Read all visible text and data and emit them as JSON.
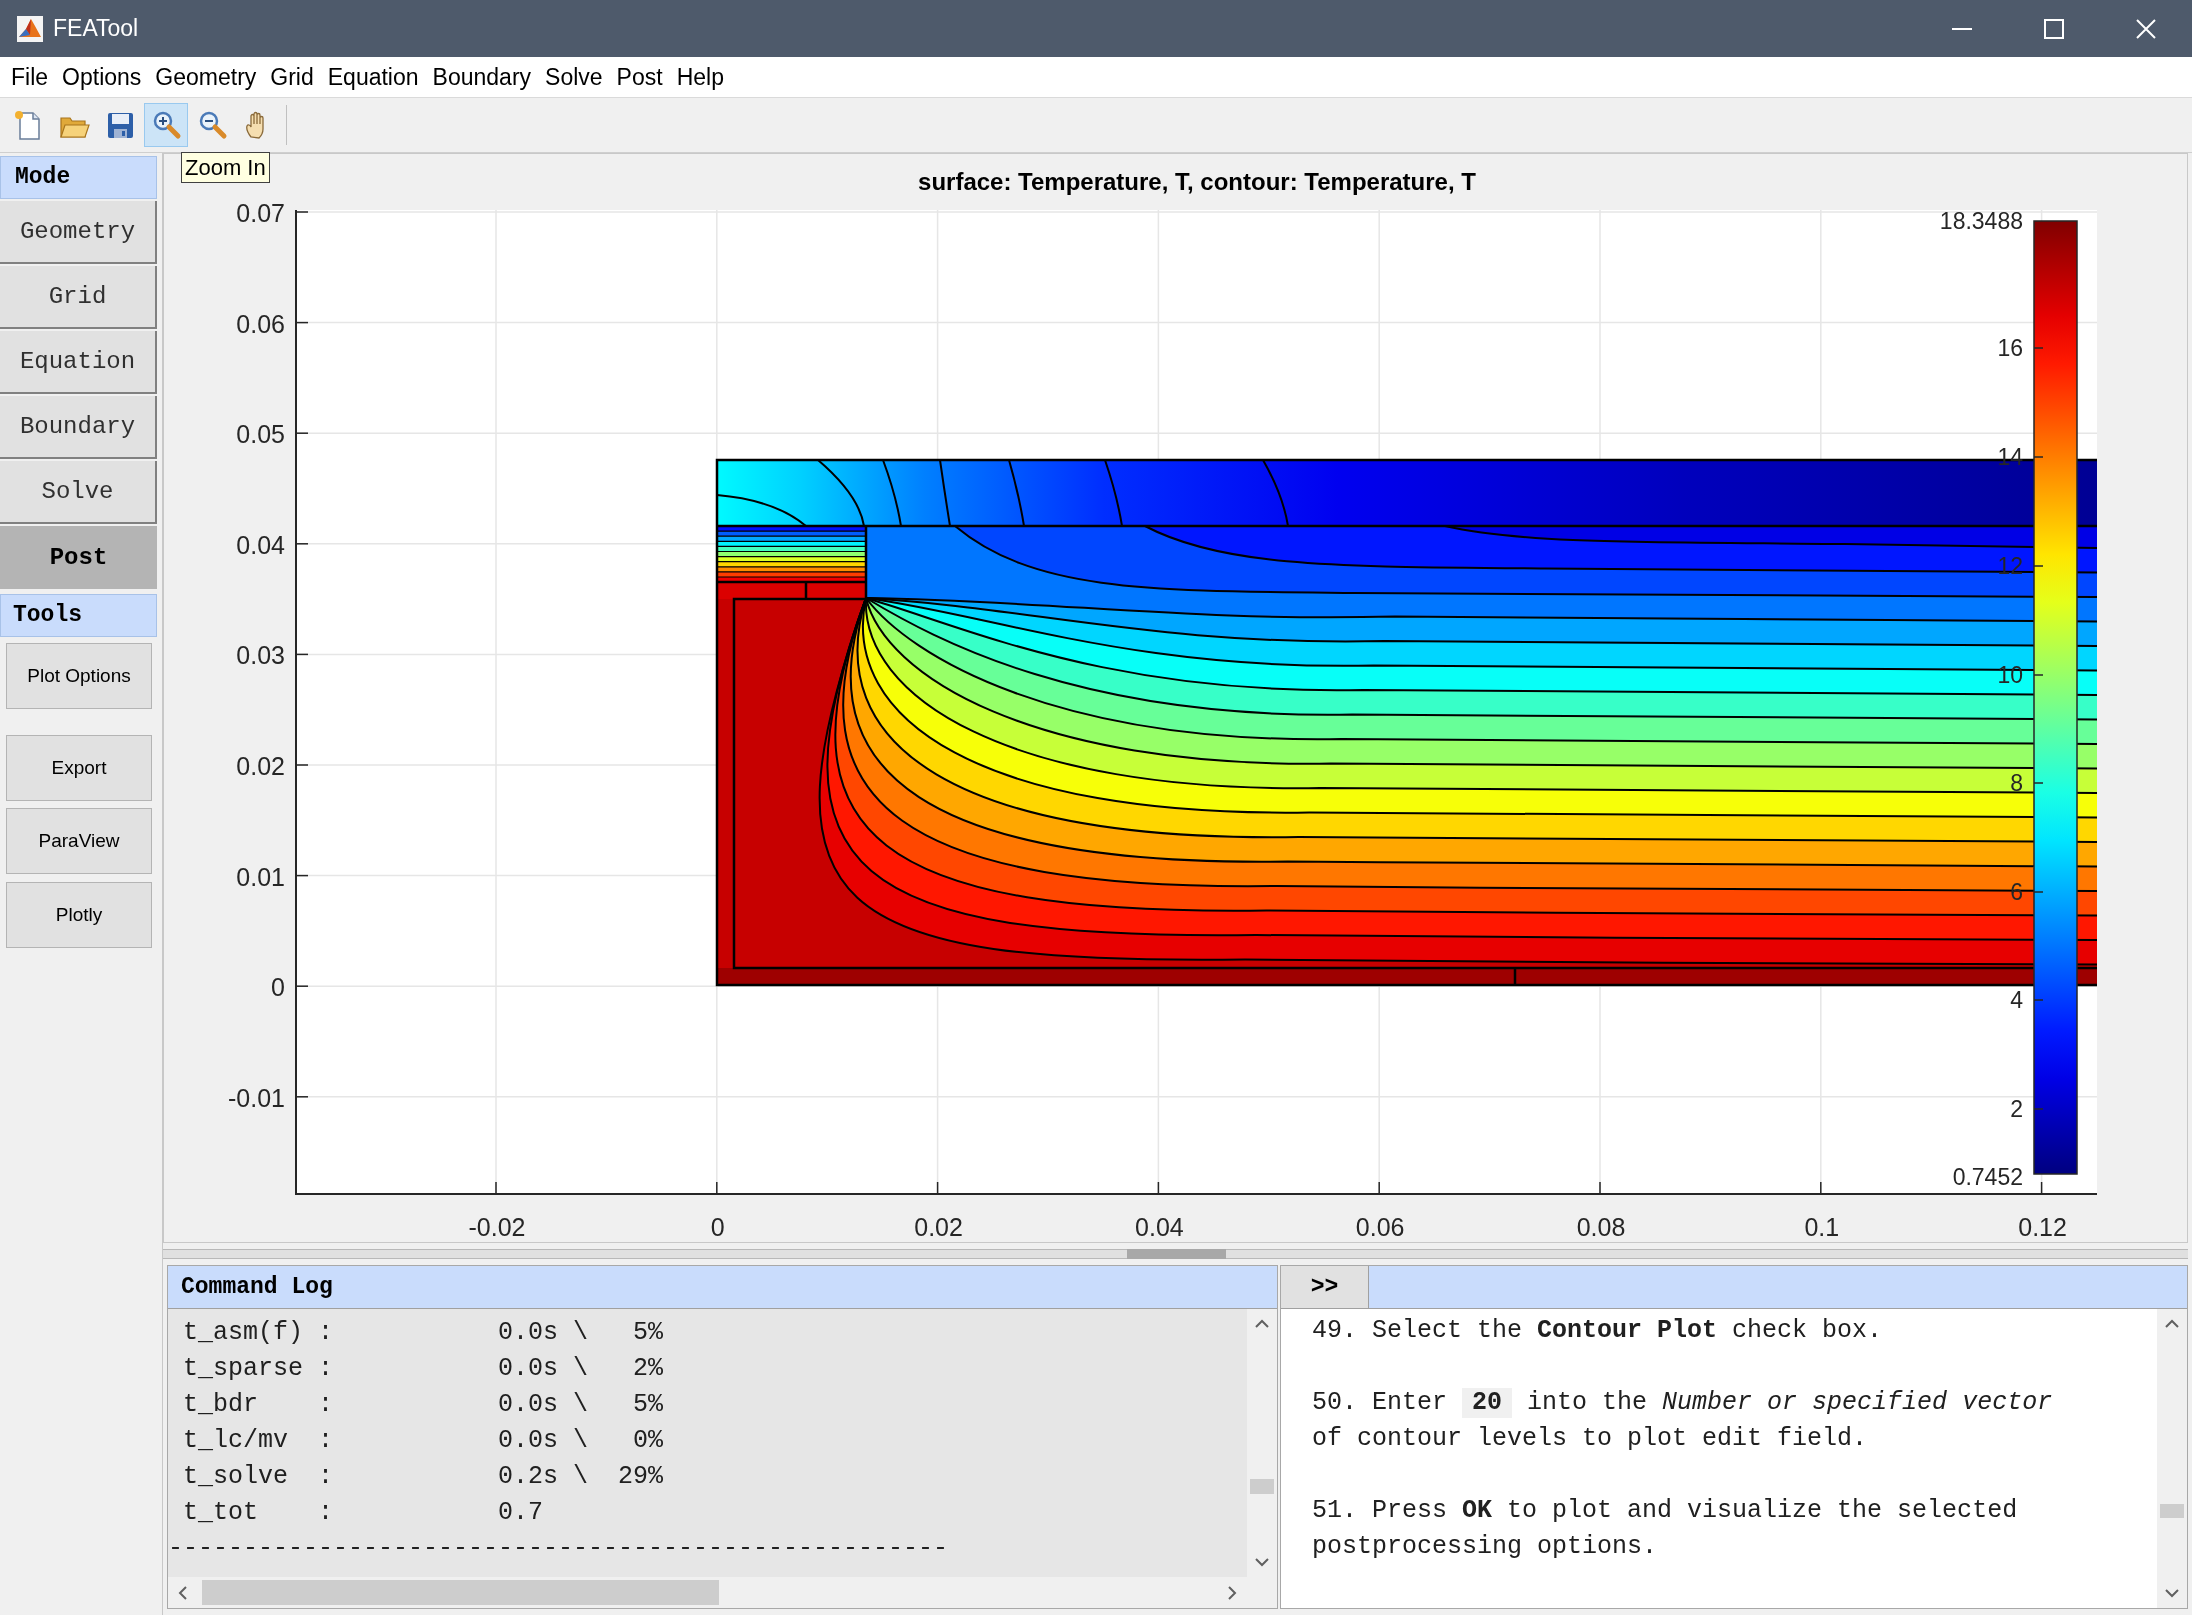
{
  "window": {
    "title": "FEATool"
  },
  "menu": [
    "File",
    "Options",
    "Geometry",
    "Grid",
    "Equation",
    "Boundary",
    "Solve",
    "Post",
    "Help"
  ],
  "toolbar": [
    {
      "kind": "new",
      "selected": false
    },
    {
      "kind": "open",
      "selected": false
    },
    {
      "kind": "save",
      "selected": false
    },
    {
      "kind": "zoom_in",
      "selected": true
    },
    {
      "kind": "zoom_out",
      "selected": false
    },
    {
      "kind": "pan",
      "selected": false
    }
  ],
  "tooltip": "Zoom In",
  "mode_panel": {
    "header": "Mode",
    "items": [
      {
        "label": "Geometry",
        "selected": false
      },
      {
        "label": "Grid",
        "selected": false
      },
      {
        "label": "Equation",
        "selected": false
      },
      {
        "label": "Boundary",
        "selected": false
      },
      {
        "label": "Solve",
        "selected": false
      },
      {
        "label": "Post",
        "selected": true
      }
    ]
  },
  "tools_panel": {
    "header": "Tools",
    "items": [
      "Plot Options",
      "Export",
      "ParaView",
      "Plotly"
    ]
  },
  "plot": {
    "title": "surface: Temperature, T, contour: Temperature, T",
    "y_ticks": [
      "0.07",
      "0.06",
      "0.05",
      "0.04",
      "0.03",
      "0.02",
      "0.01",
      "0",
      "-0.01"
    ],
    "x_ticks": [
      "-0.02",
      "0",
      "0.02",
      "0.04",
      "0.06",
      "0.08",
      "0.1",
      "0.12"
    ],
    "colorbar_ticks": [
      "18.3488",
      "16",
      "14",
      "12",
      "10",
      "8",
      "6",
      "4",
      "2",
      "0.7452"
    ]
  },
  "command_log": {
    "header": "Command Log",
    "lines": [
      " t_asm(f) :           0.0s \\   5%",
      " t_sparse :           0.0s \\   2%",
      " t_bdr    :           0.0s \\   5%",
      " t_lc/mv  :           0.0s \\   0%",
      " t_solve  :           0.2s \\  29%",
      " t_tot    :           0.7",
      "----------------------------------------------------"
    ]
  },
  "instructions": {
    "button": ">>",
    "steps": [
      {
        "text": "49. Select the **Contour Plot** check box."
      },
      {
        "text": "50. Enter",
        "value": "20",
        "text_after": "into the *Number or specified vector* of contour levels to plot edit field."
      },
      {
        "text": "51. Press **OK** to plot and visualize the selected postprocessing options."
      }
    ]
  }
}
